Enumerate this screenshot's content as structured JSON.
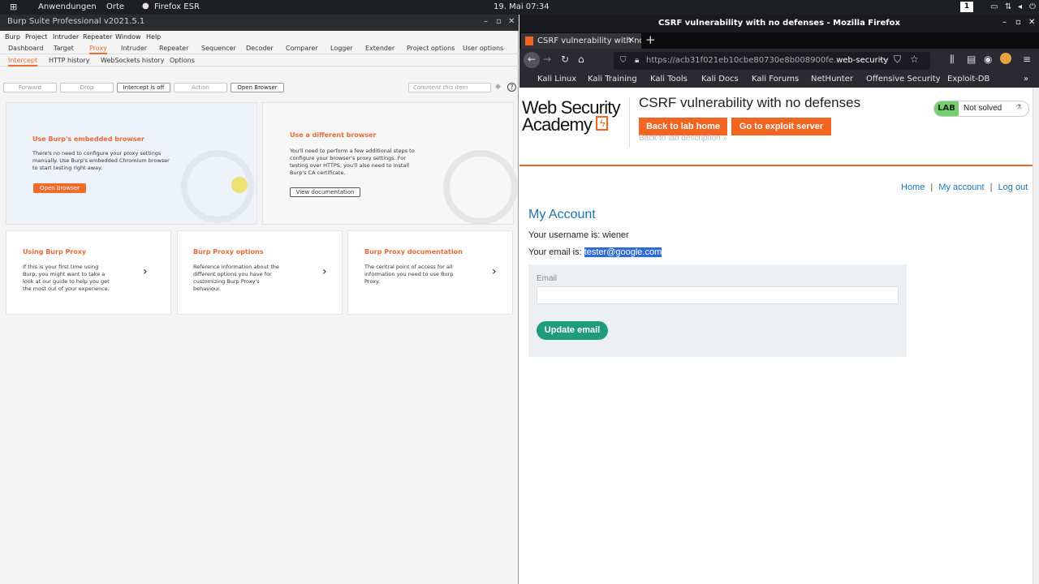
{
  "topbar": {
    "apps": "Anwendungen",
    "places": "Orte",
    "firefox": "Firefox ESR",
    "datetime": "19. Mai  07:34",
    "workspace": "1"
  },
  "burp": {
    "title": "Burp Suite Professional v2021.5.1",
    "menu": [
      "Burp",
      "Project",
      "Intruder",
      "Repeater",
      "Window",
      "Help"
    ],
    "tabs": [
      "Dashboard",
      "Target",
      "Proxy",
      "Intruder",
      "Repeater",
      "Sequencer",
      "Decoder",
      "Comparer",
      "Logger",
      "Extender",
      "Project options",
      "User options"
    ],
    "subtabs": [
      "Intercept",
      "HTTP history",
      "WebSockets history",
      "Options"
    ],
    "toolbar": {
      "forward": "Forward",
      "drop": "Drop",
      "intercept": "Intercept is off",
      "action": "Action",
      "open_browser": "Open Browser",
      "comment_placeholder": "Comment this item"
    },
    "embedded": {
      "title": "Use Burp's embedded browser",
      "text": "There's no need to configure your proxy settings manually. Use Burp's embedded Chromium browser to start testing right away.",
      "button": "Open browser"
    },
    "different": {
      "title": "Use a different browser",
      "text": "You'll need to perform a few additional steps to configure your browser's proxy settings. For testing over HTTPS, you'll also need to install Burp's CA certificate.",
      "button": "View documentation"
    },
    "cards": [
      {
        "title": "Using Burp Proxy",
        "text": "If this is your first time using Burp, you might want to take a look at our guide to help you get the most out of your experience."
      },
      {
        "title": "Burp Proxy options",
        "text": "Reference information about the different options you have for customizing Burp Proxy's behaviour."
      },
      {
        "title": "Burp Proxy documentation",
        "text": "The central point of access for all information you need to use Burp Proxy."
      }
    ]
  },
  "firefox": {
    "window_title": "CSRF vulnerability with no defenses - Mozilla Firefox",
    "tab_title": "CSRF vulnerability with no defenses",
    "url_grey": "https://acb31f021eb10cbe80730e8b008900fe.",
    "url_domain": "web-security",
    "bookmarks": [
      "Kali Linux",
      "Kali Training",
      "Kali Tools",
      "Kali Docs",
      "Kali Forums",
      "NetHunter",
      "Offensive Security",
      "Exploit-DB"
    ]
  },
  "page": {
    "logo_line1": "Web Security",
    "logo_line2": "Academy",
    "lab_title": "CSRF vulnerability with no defenses",
    "back_lab_home": "Back to lab home",
    "exploit_server": "Go to exploit server",
    "back_desc": "Back to lab description",
    "lab_badge": "LAB",
    "lab_status": "Not solved",
    "nav": {
      "home": "Home",
      "sep": "|",
      "account": "My account",
      "logout": "Log out"
    },
    "heading": "My Account",
    "username_line": "Your username is: wiener",
    "email_prefix": "Your email is: ",
    "email_value": "tester@google.com",
    "email_label": "Email",
    "update_button": "Update email"
  },
  "colors": {
    "accent": "#ef6c2d",
    "wsa_orange": "#f36421",
    "link_blue": "#1a73b5",
    "green": "#70d16d",
    "update_green": "#1f9d7a"
  }
}
